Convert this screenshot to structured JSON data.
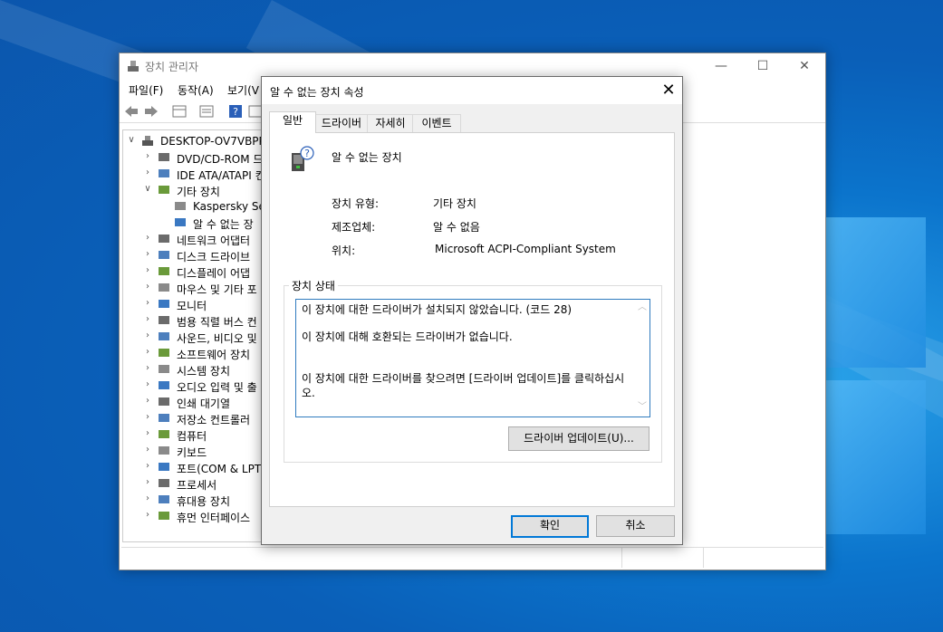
{
  "main_window": {
    "title": "장치 관리자",
    "window_buttons": {
      "minimize": "—",
      "maximize": "☐",
      "close": "✕"
    },
    "menu": [
      "파일(F)",
      "동작(A)",
      "보기(V"
    ],
    "tree": {
      "root": "DESKTOP-OV7VBPP",
      "items": [
        {
          "label": "DVD/CD-ROM 드",
          "expanded": false,
          "level": 1
        },
        {
          "label": "IDE ATA/ATAPI 컨",
          "expanded": false,
          "level": 1
        },
        {
          "label": "기타 장치",
          "expanded": true,
          "level": 1
        },
        {
          "label": "Kaspersky Se",
          "level": 2
        },
        {
          "label": "알 수 없는 장",
          "level": 2
        },
        {
          "label": "네트워크 어댑터",
          "expanded": false,
          "level": 1
        },
        {
          "label": "디스크 드라이브",
          "expanded": false,
          "level": 1
        },
        {
          "label": "디스플레이 어댑",
          "expanded": false,
          "level": 1
        },
        {
          "label": "마우스 및 기타 포",
          "expanded": false,
          "level": 1
        },
        {
          "label": "모니터",
          "expanded": false,
          "level": 1
        },
        {
          "label": "범용 직렬 버스 컨",
          "expanded": false,
          "level": 1
        },
        {
          "label": "사운드, 비디오 및",
          "expanded": false,
          "level": 1
        },
        {
          "label": "소프트웨어 장치",
          "expanded": false,
          "level": 1
        },
        {
          "label": "시스템 장치",
          "expanded": false,
          "level": 1
        },
        {
          "label": "오디오 입력 및 출",
          "expanded": false,
          "level": 1
        },
        {
          "label": "인쇄 대기열",
          "expanded": false,
          "level": 1
        },
        {
          "label": "저장소 컨트롤러",
          "expanded": false,
          "level": 1
        },
        {
          "label": "컴퓨터",
          "expanded": false,
          "level": 1
        },
        {
          "label": "키보드",
          "expanded": false,
          "level": 1
        },
        {
          "label": "포트(COM & LPT",
          "expanded": false,
          "level": 1
        },
        {
          "label": "프로세서",
          "expanded": false,
          "level": 1
        },
        {
          "label": "휴대용 장치",
          "expanded": false,
          "level": 1
        },
        {
          "label": "휴먼 인터페이스",
          "expanded": false,
          "level": 1
        }
      ]
    }
  },
  "dialog": {
    "title": "알 수 없는 장치 속성",
    "close": "✕",
    "tabs": [
      "일반",
      "드라이버",
      "자세히",
      "이벤트"
    ],
    "active_tab": 0,
    "device_name": "알 수 없는 장치",
    "properties": {
      "type_label": "장치 유형:",
      "type_value": "기타 장치",
      "manufacturer_label": "제조업체:",
      "manufacturer_value": "알 수 없음",
      "location_label": "위치:",
      "location_value": "Microsoft ACPI-Compliant System"
    },
    "status": {
      "legend": "장치 상태",
      "line1": "이 장치에 대한 드라이버가 설치되지 않았습니다. (코드 28)",
      "line2": "이 장치에 대해 호환되는 드라이버가 없습니다.",
      "line3": "이 장치에 대한 드라이버를 찾으려면 [드라이버 업데이트]를 클릭하십시오."
    },
    "update_driver_button": "드라이버 업데이트(U)...",
    "ok_button": "확인",
    "cancel_button": "취소"
  },
  "colors": {
    "accent": "#0078d7",
    "desktop": "#0a5fb8"
  }
}
